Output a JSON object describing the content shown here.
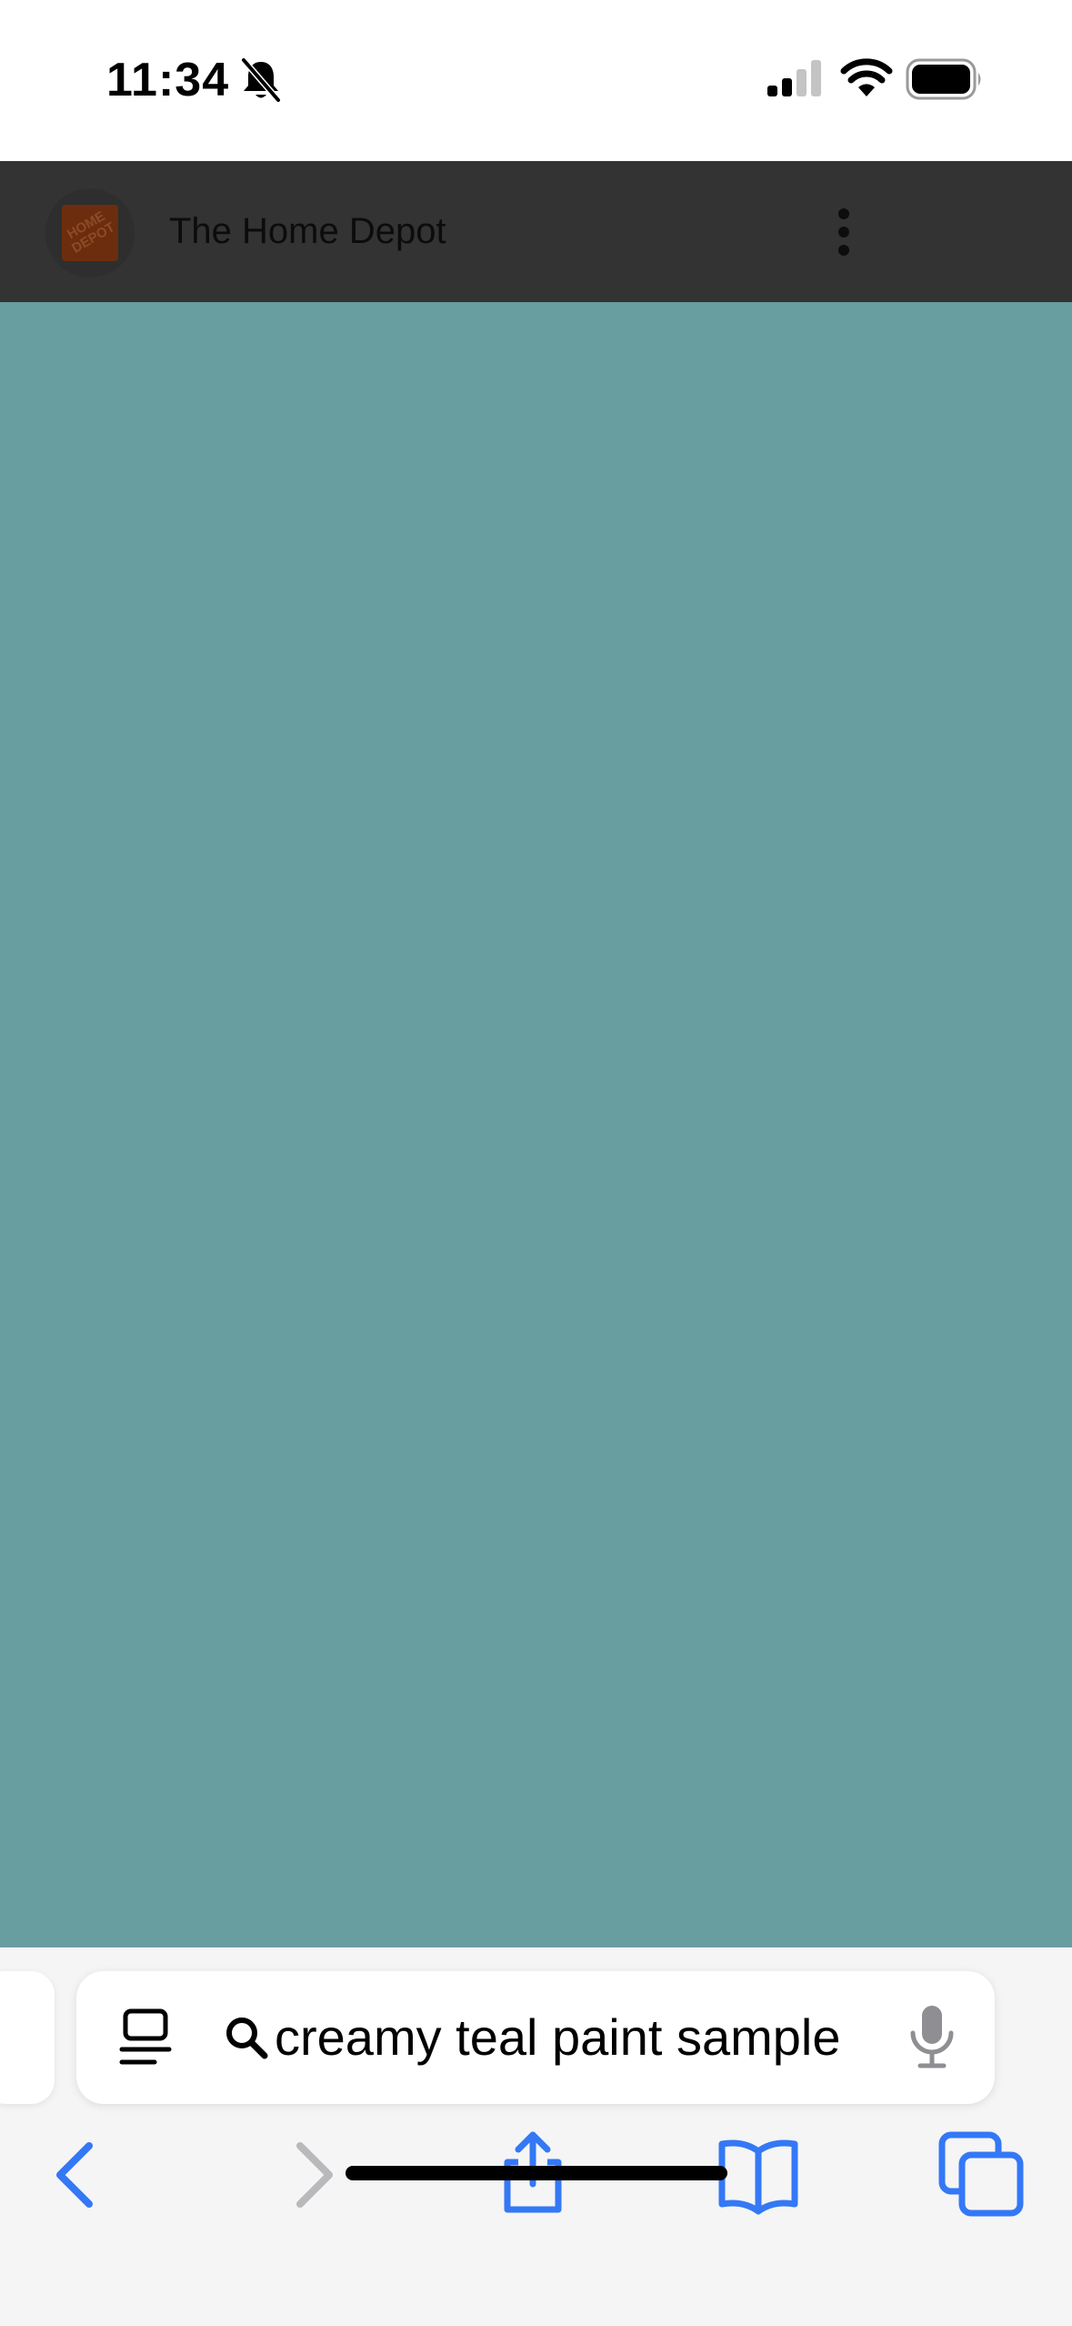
{
  "status_bar": {
    "time": "11:34",
    "icons": [
      "bell-slash-icon",
      "cellular-signal-icon",
      "wifi-icon",
      "battery-icon"
    ]
  },
  "header": {
    "title": "The Home Depot",
    "logo_text": "HOME DEPOT",
    "menu_icon": "kebab-menu-icon"
  },
  "content": {
    "preview_color": "#689e9f"
  },
  "toolbar": {
    "address_text": "creamy teal paint sample",
    "icons": {
      "reader": "reader-mode-icon",
      "search": "search-icon",
      "mic": "microphone-icon",
      "back": "chevron-left-icon",
      "forward": "chevron-right-icon",
      "share": "share-icon",
      "bookmarks": "book-icon",
      "tabs": "tabs-icon"
    },
    "accent_color": "#3478f6"
  }
}
